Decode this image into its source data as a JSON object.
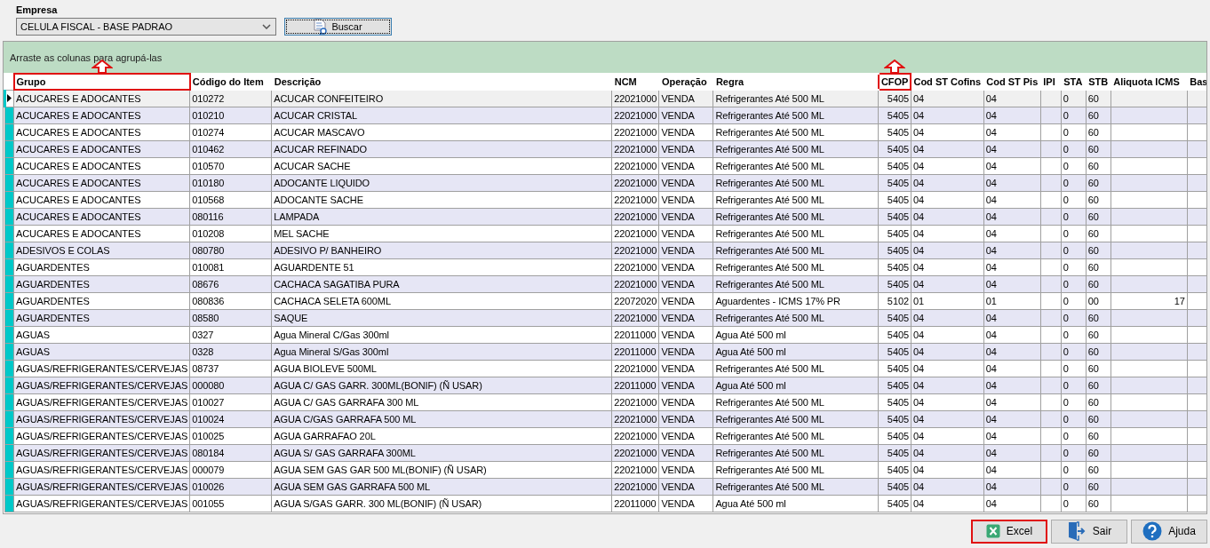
{
  "empresa": {
    "label": "Empresa",
    "value": "CELULA FISCAL - BASE PADRAO",
    "search_button": "Buscar"
  },
  "group_panel": {
    "hint": "Arraste as colunas para agrupá-las"
  },
  "table": {
    "columns": [
      {
        "label": "Grupo",
        "highlighted": true,
        "kind": "text"
      },
      {
        "label": "Código do Item",
        "highlighted": false,
        "kind": "text"
      },
      {
        "label": "Descrição",
        "highlighted": false,
        "kind": "text"
      },
      {
        "label": "NCM",
        "highlighted": false,
        "kind": "text"
      },
      {
        "label": "Operação",
        "highlighted": false,
        "kind": "text"
      },
      {
        "label": "Regra",
        "highlighted": false,
        "kind": "text"
      },
      {
        "label": "CFOP",
        "highlighted": true,
        "kind": "number"
      },
      {
        "label": "Cod ST Cofins",
        "highlighted": false,
        "kind": "text"
      },
      {
        "label": "Cod ST Pis",
        "highlighted": false,
        "kind": "text"
      },
      {
        "label": "IPI",
        "highlighted": false,
        "kind": "text"
      },
      {
        "label": "STA",
        "highlighted": false,
        "kind": "text"
      },
      {
        "label": "STB",
        "highlighted": false,
        "kind": "text"
      },
      {
        "label": "Aliquota ICMS",
        "highlighted": false,
        "kind": "number"
      },
      {
        "label": "Bas",
        "highlighted": false,
        "kind": "text"
      }
    ],
    "rows": [
      {
        "selected": true,
        "cells": [
          "ACUCARES E ADOCANTES",
          "010272",
          "ACUCAR CONFEITEIRO",
          "22021000",
          "VENDA",
          "Refrigerantes Até 500 ML",
          "5405",
          "04",
          "04",
          null,
          "0",
          "60",
          null,
          null
        ]
      },
      {
        "selected": false,
        "cells": [
          "ACUCARES E ADOCANTES",
          "010210",
          "ACUCAR CRISTAL",
          "22021000",
          "VENDA",
          "Refrigerantes Até 500 ML",
          "5405",
          "04",
          "04",
          null,
          "0",
          "60",
          null,
          null
        ]
      },
      {
        "selected": false,
        "cells": [
          "ACUCARES E ADOCANTES",
          "010274",
          "ACUCAR MASCAVO",
          "22021000",
          "VENDA",
          "Refrigerantes Até 500 ML",
          "5405",
          "04",
          "04",
          null,
          "0",
          "60",
          null,
          null
        ]
      },
      {
        "selected": false,
        "cells": [
          "ACUCARES E ADOCANTES",
          "010462",
          "ACUCAR REFINADO",
          "22021000",
          "VENDA",
          "Refrigerantes Até 500 ML",
          "5405",
          "04",
          "04",
          null,
          "0",
          "60",
          null,
          null
        ]
      },
      {
        "selected": false,
        "cells": [
          "ACUCARES E ADOCANTES",
          "010570",
          "ACUCAR SACHE",
          "22021000",
          "VENDA",
          "Refrigerantes Até 500 ML",
          "5405",
          "04",
          "04",
          null,
          "0",
          "60",
          null,
          null
        ]
      },
      {
        "selected": false,
        "cells": [
          "ACUCARES E ADOCANTES",
          "010180",
          "ADOCANTE LIQUIDO",
          "22021000",
          "VENDA",
          "Refrigerantes Até 500 ML",
          "5405",
          "04",
          "04",
          null,
          "0",
          "60",
          null,
          null
        ]
      },
      {
        "selected": false,
        "cells": [
          "ACUCARES E ADOCANTES",
          "010568",
          "ADOCANTE SACHE",
          "22021000",
          "VENDA",
          "Refrigerantes Até 500 ML",
          "5405",
          "04",
          "04",
          null,
          "0",
          "60",
          null,
          null
        ]
      },
      {
        "selected": false,
        "cells": [
          "ACUCARES E ADOCANTES",
          "080116",
          "LAMPADA",
          "22021000",
          "VENDA",
          "Refrigerantes Até 500 ML",
          "5405",
          "04",
          "04",
          null,
          "0",
          "60",
          null,
          null
        ]
      },
      {
        "selected": false,
        "cells": [
          "ACUCARES E ADOCANTES",
          "010208",
          "MEL SACHE",
          "22021000",
          "VENDA",
          "Refrigerantes Até 500 ML",
          "5405",
          "04",
          "04",
          null,
          "0",
          "60",
          null,
          null
        ]
      },
      {
        "selected": false,
        "cells": [
          "ADESIVOS E COLAS",
          "080780",
          "ADESIVO P/ BANHEIRO",
          "22021000",
          "VENDA",
          "Refrigerantes Até 500 ML",
          "5405",
          "04",
          "04",
          null,
          "0",
          "60",
          null,
          null
        ]
      },
      {
        "selected": false,
        "cells": [
          "AGUARDENTES",
          "010081",
          "AGUARDENTE 51",
          "22021000",
          "VENDA",
          "Refrigerantes Até 500 ML",
          "5405",
          "04",
          "04",
          null,
          "0",
          "60",
          null,
          null
        ]
      },
      {
        "selected": false,
        "cells": [
          "AGUARDENTES",
          "08676",
          "CACHACA SAGATIBA PURA",
          "22021000",
          "VENDA",
          "Refrigerantes Até 500 ML",
          "5405",
          "04",
          "04",
          null,
          "0",
          "60",
          null,
          null
        ]
      },
      {
        "selected": false,
        "cells": [
          "AGUARDENTES",
          "080836",
          "CACHACA SELETA 600ML",
          "22072020",
          "VENDA",
          "Aguardentes -  ICMS 17% PR",
          "5102",
          "01",
          "01",
          null,
          "0",
          "00",
          "17",
          null
        ]
      },
      {
        "selected": false,
        "cells": [
          "AGUARDENTES",
          "08580",
          "SAQUE",
          "22021000",
          "VENDA",
          "Refrigerantes Até 500 ML",
          "5405",
          "04",
          "04",
          null,
          "0",
          "60",
          null,
          null
        ]
      },
      {
        "selected": false,
        "cells": [
          "AGUAS",
          "0327",
          "Agua Mineral C/Gas 300ml",
          "22011000",
          "VENDA",
          "Agua Até 500 ml",
          "5405",
          "04",
          "04",
          null,
          "0",
          "60",
          null,
          null
        ]
      },
      {
        "selected": false,
        "cells": [
          "AGUAS",
          "0328",
          "Agua Mineral S/Gas 300ml",
          "22011000",
          "VENDA",
          "Agua Até 500 ml",
          "5405",
          "04",
          "04",
          null,
          "0",
          "60",
          null,
          null
        ]
      },
      {
        "selected": false,
        "cells": [
          "AGUAS/REFRIGERANTES/CERVEJAS",
          "08737",
          "AGUA BIOLEVE 500ML",
          "22021000",
          "VENDA",
          "Refrigerantes Até 500 ML",
          "5405",
          "04",
          "04",
          null,
          "0",
          "60",
          null,
          null
        ]
      },
      {
        "selected": false,
        "cells": [
          "AGUAS/REFRIGERANTES/CERVEJAS",
          "000080",
          "AGUA C/ GAS GARR. 300ML(BONIF) (Ñ USAR)",
          "22011000",
          "VENDA",
          "Agua Até 500 ml",
          "5405",
          "04",
          "04",
          null,
          "0",
          "60",
          null,
          null
        ]
      },
      {
        "selected": false,
        "cells": [
          "AGUAS/REFRIGERANTES/CERVEJAS",
          "010027",
          "AGUA C/ GAS GARRAFA 300 ML",
          "22021000",
          "VENDA",
          "Refrigerantes Até 500 ML",
          "5405",
          "04",
          "04",
          null,
          "0",
          "60",
          null,
          null
        ]
      },
      {
        "selected": false,
        "cells": [
          "AGUAS/REFRIGERANTES/CERVEJAS",
          "010024",
          "AGUA C/GAS GARRAFA 500 ML",
          "22021000",
          "VENDA",
          "Refrigerantes Até 500 ML",
          "5405",
          "04",
          "04",
          null,
          "0",
          "60",
          null,
          null
        ]
      },
      {
        "selected": false,
        "cells": [
          "AGUAS/REFRIGERANTES/CERVEJAS",
          "010025",
          "AGUA GARRAFAO 20L",
          "22021000",
          "VENDA",
          "Refrigerantes Até 500 ML",
          "5405",
          "04",
          "04",
          null,
          "0",
          "60",
          null,
          null
        ]
      },
      {
        "selected": false,
        "cells": [
          "AGUAS/REFRIGERANTES/CERVEJAS",
          "080184",
          "AGUA S/ GAS GARRAFA 300ML",
          "22021000",
          "VENDA",
          "Refrigerantes Até 500 ML",
          "5405",
          "04",
          "04",
          null,
          "0",
          "60",
          null,
          null
        ]
      },
      {
        "selected": false,
        "cells": [
          "AGUAS/REFRIGERANTES/CERVEJAS",
          "000079",
          "AGUA SEM GAS GAR 500 ML(BONIF) (Ñ USAR)",
          "22021000",
          "VENDA",
          "Refrigerantes Até 500 ML",
          "5405",
          "04",
          "04",
          null,
          "0",
          "60",
          null,
          null
        ]
      },
      {
        "selected": false,
        "cells": [
          "AGUAS/REFRIGERANTES/CERVEJAS",
          "010026",
          "AGUA SEM GAS GARRAFA 500 ML",
          "22021000",
          "VENDA",
          "Refrigerantes Até 500 ML",
          "5405",
          "04",
          "04",
          null,
          "0",
          "60",
          null,
          null
        ]
      },
      {
        "selected": false,
        "cells": [
          "AGUAS/REFRIGERANTES/CERVEJAS",
          "001055",
          "AGUA S/GAS GARR. 300 ML(BONIF) (Ñ USAR)",
          "22011000",
          "VENDA",
          "Agua Até 500 ml",
          "5405",
          "04",
          "04",
          null,
          "0",
          "60",
          null,
          null
        ]
      }
    ]
  },
  "buttons": [
    {
      "kind": "excel",
      "label": "Excel",
      "highlighted": true
    },
    {
      "kind": "exit",
      "label": "Sair",
      "highlighted": false
    },
    {
      "kind": "help",
      "label": "Ajuda",
      "highlighted": false
    }
  ]
}
